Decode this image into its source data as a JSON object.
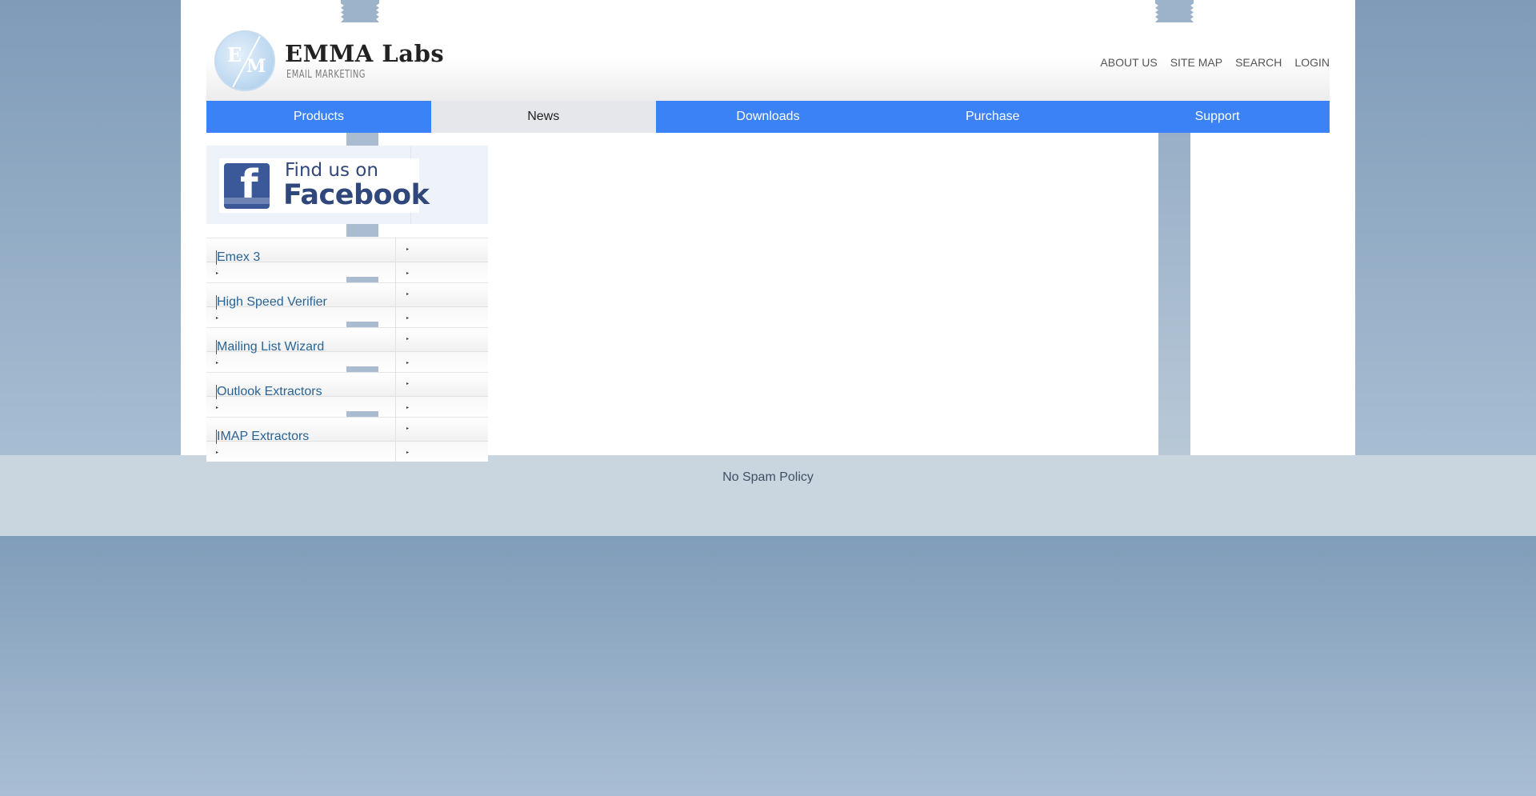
{
  "brand": {
    "logo_mark_left": "E",
    "logo_mark_right": "M",
    "name": "EMMA Labs",
    "tagline": "EMAIL MARKETING"
  },
  "top_links": [
    {
      "label": "ABOUT US"
    },
    {
      "label": "SITE MAP"
    },
    {
      "label": "SEARCH"
    },
    {
      "label": "LOGIN"
    }
  ],
  "nav": {
    "items": [
      {
        "label": "Products"
      },
      {
        "label": "News",
        "active": true
      },
      {
        "label": "Downloads"
      },
      {
        "label": "Purchase"
      },
      {
        "label": "Support"
      }
    ],
    "accent_color": "#3b82f6",
    "active_color": "#e5e7eb"
  },
  "facebook": {
    "line1": "Find us on",
    "line2": "Facebook",
    "icon": "facebook-icon",
    "brand_color": "#3b5998"
  },
  "products": [
    {
      "label": "Emex 3"
    },
    {
      "label": "High Speed Verifier"
    },
    {
      "label": "Mailing List Wizard"
    },
    {
      "label": "Outlook Extractors"
    },
    {
      "label": "IMAP Extractors"
    }
  ],
  "footer": {
    "link": "No Spam Policy"
  }
}
